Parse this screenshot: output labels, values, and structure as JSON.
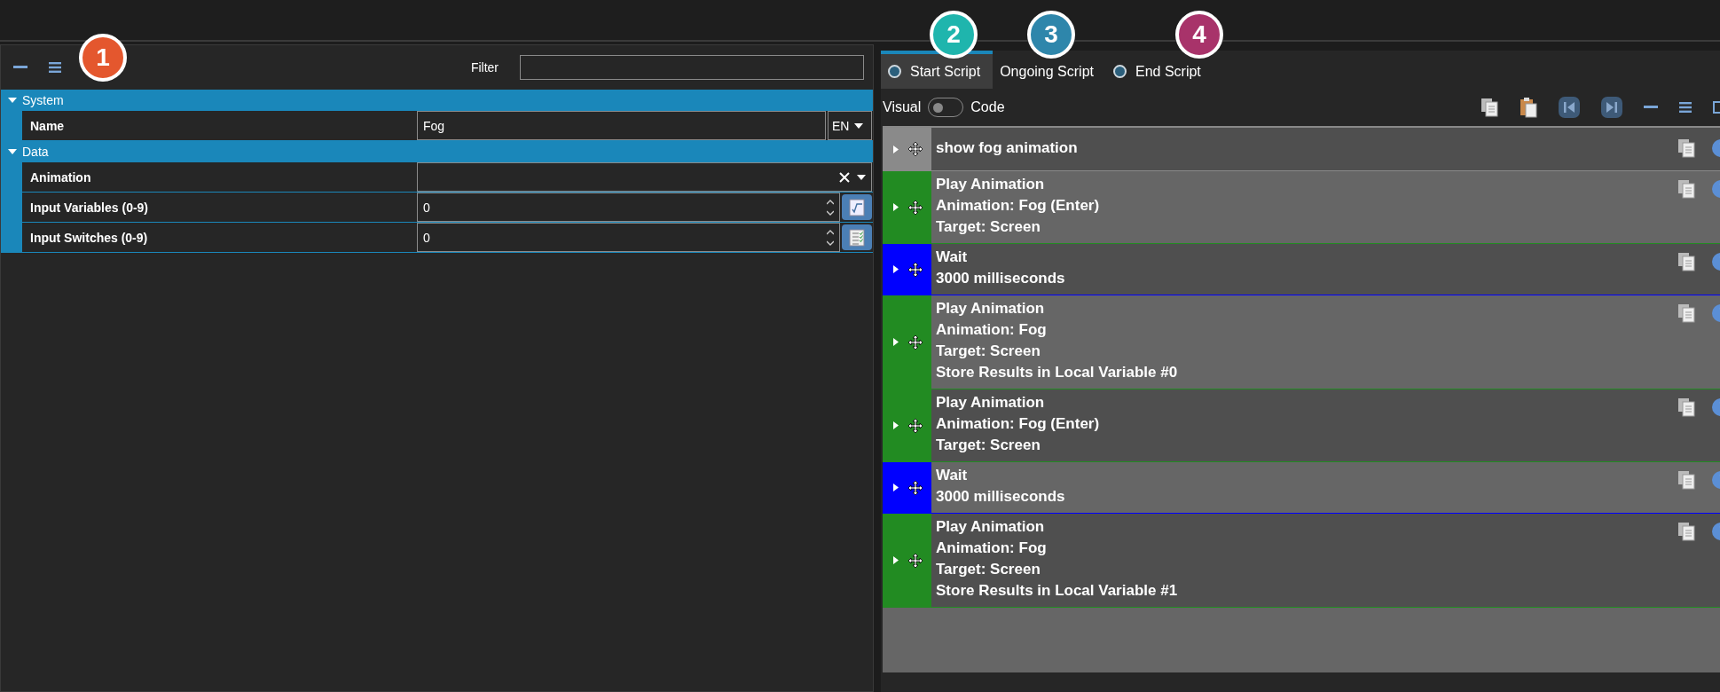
{
  "callouts": [
    {
      "label": "1",
      "color": "#e4572e"
    },
    {
      "label": "2",
      "color": "#1fb5ad"
    },
    {
      "label": "3",
      "color": "#2e86ab"
    },
    {
      "label": "4",
      "color": "#a8336a"
    }
  ],
  "properties": {
    "filter": {
      "label": "Filter"
    },
    "sections": [
      {
        "label": "System",
        "expanded": true,
        "children": [
          {
            "kind": "text",
            "label": "Name",
            "value": "Fog",
            "language": "EN"
          }
        ]
      },
      {
        "label": "Data",
        "expanded": true,
        "children": [
          {
            "kind": "combo",
            "label": "Animation"
          },
          {
            "kind": "variables",
            "label": "Input Variables (0-9)",
            "value": "0"
          },
          {
            "kind": "switches",
            "label": "Input Switches (0-9)",
            "value": "0"
          }
        ]
      }
    ]
  },
  "script": {
    "tabs": [
      {
        "label": "Start Script",
        "selected": true,
        "has_script": true
      },
      {
        "label": "Ongoing Script",
        "selected": false,
        "has_script": false
      },
      {
        "label": "End Script",
        "selected": false,
        "has_script": true
      }
    ],
    "mode_toggle": {
      "left": "Visual",
      "right": "Code",
      "on": false
    },
    "commands": [
      {
        "color": "#8a8a8a",
        "lines": [
          "show fog animation"
        ]
      },
      {
        "color": "#228b22",
        "lines": [
          "Play Animation",
          "Animation: Fog (Enter)",
          "Target: Screen"
        ]
      },
      {
        "color": "#0000ff",
        "lines": [
          "Wait",
          "3000 milliseconds"
        ]
      },
      {
        "color": "#228b22",
        "lines": [
          "Play Animation",
          "Animation: Fog",
          "Target: Screen",
          "Store Results in Local Variable #0"
        ]
      },
      {
        "color": "#228b22",
        "lines": [
          "Play Animation",
          "Animation: Fog (Enter)",
          "Target: Screen"
        ]
      },
      {
        "color": "#0000ff",
        "lines": [
          "Wait",
          "3000 milliseconds"
        ]
      },
      {
        "color": "#228b22",
        "lines": [
          "Play Animation",
          "Animation: Fog",
          "Target: Screen",
          "Store Results in Local Variable #1"
        ]
      }
    ]
  }
}
